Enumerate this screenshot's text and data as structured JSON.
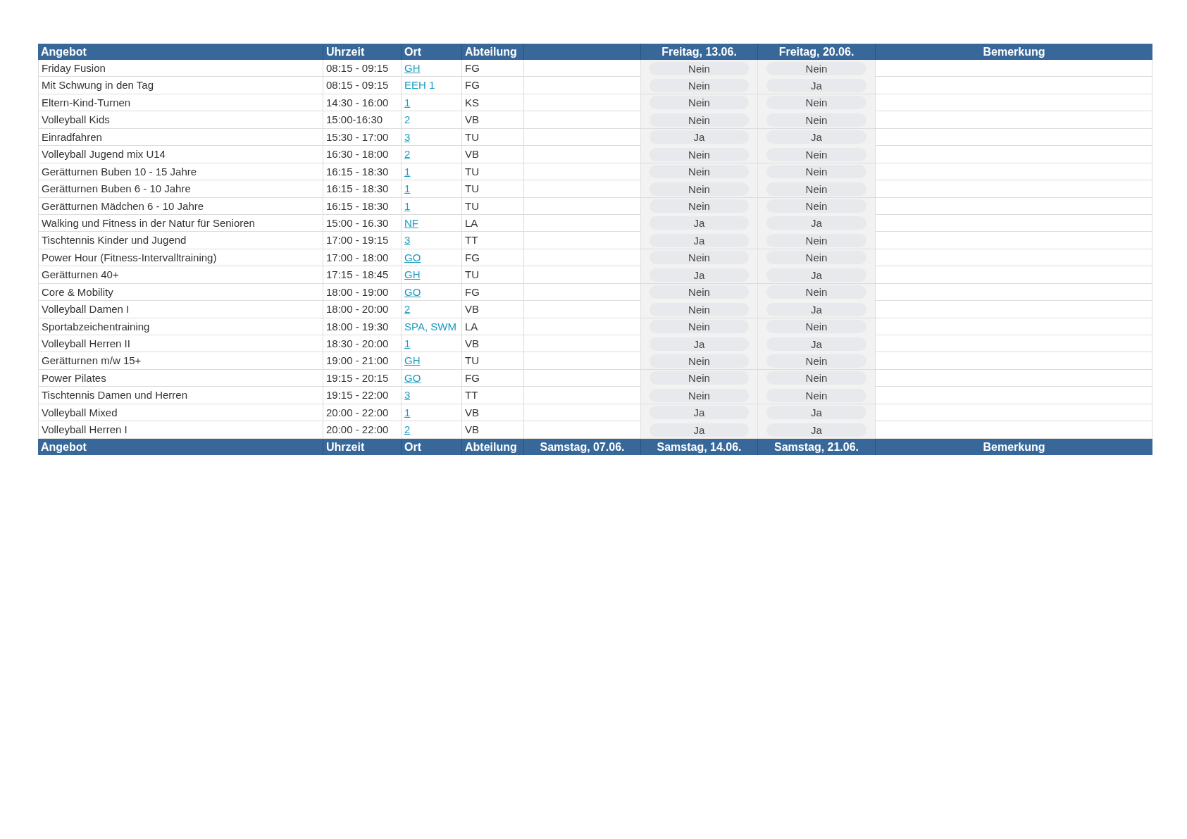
{
  "table": {
    "header": [
      "Angebot",
      "Uhrzeit",
      "Ort",
      "Abteilung",
      "Freitag, 13.06.",
      "Freitag, 20.06.",
      "Bemerkung"
    ],
    "rows": [
      {
        "angebot": "Friday Fusion",
        "uhrzeit": "08:15 - 09:15",
        "ort": "GH",
        "ort_link": true,
        "abteilung": "FG",
        "tag_1": "Nein",
        "tag_2": "Nein"
      },
      {
        "angebot": "Mit Schwung in den Tag",
        "uhrzeit": "08:15 - 09:15",
        "ort": "EEH 1",
        "ort_link": false,
        "abteilung": "FG",
        "tag_1": "Nein",
        "tag_2": "Ja"
      },
      {
        "angebot": "Eltern-Kind-Turnen",
        "uhrzeit": "14:30 - 16:00",
        "ort": "1",
        "ort_link": true,
        "abteilung": "KS",
        "tag_1": "Nein",
        "tag_2": "Nein"
      },
      {
        "angebot": "Volleyball Kids",
        "uhrzeit": "15:00-16:30",
        "ort": "2",
        "ort_link": false,
        "abteilung": "VB",
        "tag_1": "Nein",
        "tag_2": "Nein"
      },
      {
        "angebot": "Einradfahren",
        "uhrzeit": "15:30 - 17:00",
        "ort": "3",
        "ort_link": true,
        "abteilung": "TU",
        "tag_1": "Ja",
        "tag_2": "Ja"
      },
      {
        "angebot": "Volleyball Jugend mix U14",
        "uhrzeit": "16:30 - 18:00",
        "ort": "2",
        "ort_link": true,
        "abteilung": "VB",
        "tag_1": "Nein",
        "tag_2": "Nein"
      },
      {
        "angebot": "Gerätturnen Buben 10 - 15 Jahre",
        "uhrzeit": "16:15 - 18:30",
        "ort": "1",
        "ort_link": true,
        "abteilung": "TU",
        "tag_1": "Nein",
        "tag_2": "Nein"
      },
      {
        "angebot": "Gerätturnen Buben 6 - 10 Jahre",
        "uhrzeit": "16:15 - 18:30",
        "ort": "1",
        "ort_link": true,
        "abteilung": "TU",
        "tag_1": "Nein",
        "tag_2": "Nein"
      },
      {
        "angebot": "Gerätturnen Mädchen 6 - 10 Jahre",
        "uhrzeit": "16:15 - 18:30",
        "ort": "1",
        "ort_link": true,
        "abteilung": "TU",
        "tag_1": "Nein",
        "tag_2": "Nein"
      },
      {
        "angebot": "Walking und Fitness in der Natur für Senioren",
        "uhrzeit": "15:00 - 16.30",
        "ort": "NF",
        "ort_link": true,
        "abteilung": "LA",
        "tag_1": "Ja",
        "tag_2": "Ja"
      },
      {
        "angebot": "Tischtennis Kinder und Jugend",
        "uhrzeit": "17:00 - 19:15",
        "ort": "3",
        "ort_link": true,
        "abteilung": "TT",
        "tag_1": "Ja",
        "tag_2": "Nein"
      },
      {
        "angebot": "Power Hour (Fitness-Intervalltraining)",
        "uhrzeit": "17:00 - 18:00",
        "ort": "GO",
        "ort_link": true,
        "abteilung": "FG",
        "tag_1": "Nein",
        "tag_2": "Nein"
      },
      {
        "angebot": "Gerätturnen 40+",
        "uhrzeit": "17:15 - 18:45",
        "ort": "GH",
        "ort_link": true,
        "abteilung": "TU",
        "tag_1": "Ja",
        "tag_2": "Ja"
      },
      {
        "angebot": "Core & Mobility",
        "uhrzeit": "18:00 - 19:00",
        "ort": "GO",
        "ort_link": true,
        "abteilung": "FG",
        "tag_1": "Nein",
        "tag_2": "Nein"
      },
      {
        "angebot": "Volleyball Damen I",
        "uhrzeit": "18:00 - 20:00",
        "ort": "2",
        "ort_link": true,
        "abteilung": "VB",
        "tag_1": "Nein",
        "tag_2": "Ja"
      },
      {
        "angebot": "Sportabzeichentraining",
        "uhrzeit": "18:00 - 19:30",
        "ort": "SPA, SWM",
        "ort_link": false,
        "abteilung": "LA",
        "tag_1": "Nein",
        "tag_2": "Nein"
      },
      {
        "angebot": "Volleyball Herren II",
        "uhrzeit": "18:30 - 20:00",
        "ort": "1",
        "ort_link": true,
        "abteilung": "VB",
        "tag_1": "Ja",
        "tag_2": "Ja"
      },
      {
        "angebot": "Gerätturnen m/w 15+",
        "uhrzeit": "19:00 - 21:00",
        "ort": "GH",
        "ort_link": true,
        "abteilung": "TU",
        "tag_1": "Nein",
        "tag_2": "Nein"
      },
      {
        "angebot": "Power Pilates",
        "uhrzeit": "19:15 - 20:15",
        "ort": "GO",
        "ort_link": true,
        "abteilung": "FG",
        "tag_1": "Nein",
        "tag_2": "Nein"
      },
      {
        "angebot": "Tischtennis Damen und Herren",
        "uhrzeit": "19:15 - 22:00",
        "ort": "3",
        "ort_link": true,
        "abteilung": "TT",
        "tag_1": "Nein",
        "tag_2": "Nein"
      },
      {
        "angebot": "Volleyball Mixed",
        "uhrzeit": "20:00 - 22:00",
        "ort": "1",
        "ort_link": true,
        "abteilung": "VB",
        "tag_1": "Ja",
        "tag_2": "Ja"
      },
      {
        "angebot": "Volleyball Herren I",
        "uhrzeit": "20:00 - 22:00",
        "ort": "2",
        "ort_link": true,
        "abteilung": "VB",
        "tag_1": "Ja",
        "tag_2": "Ja"
      }
    ],
    "footer": [
      "Angebot",
      "Uhrzeit",
      "Ort",
      "Abteilung",
      "Samstag, 07.06.",
      "Samstag, 14.06.",
      "Samstag, 21.06.",
      "Bemerkung"
    ]
  }
}
